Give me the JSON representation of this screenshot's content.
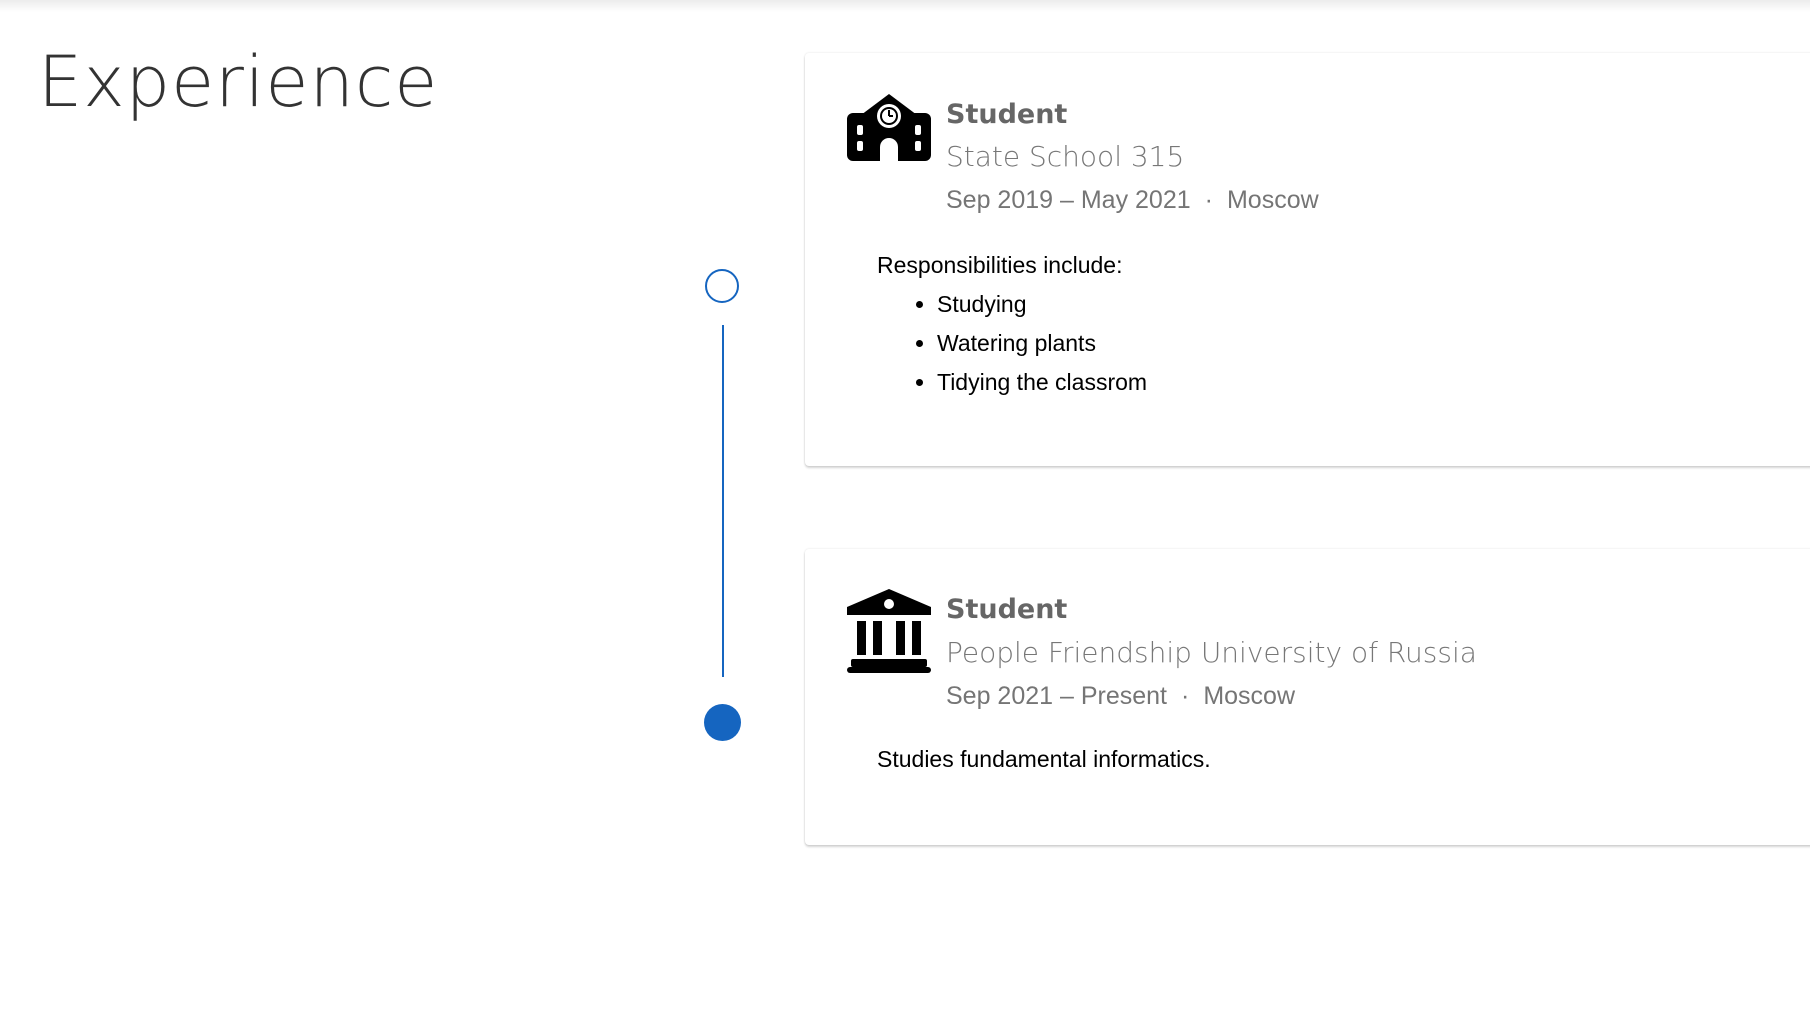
{
  "page": {
    "title": "Experience"
  },
  "colors": {
    "accent": "#1565c0",
    "muted_text": "#757575",
    "title_text": "#333333"
  },
  "timeline": {
    "items": [
      {
        "state": "open"
      },
      {
        "state": "filled"
      }
    ]
  },
  "entries": [
    {
      "icon": "school-icon",
      "title": "Student",
      "organization": "State School 315",
      "dates": "Sep 2019 – May 2021",
      "separator": "·",
      "location": "Moscow",
      "intro": "Responsibilities include:",
      "bullets": [
        "Studying",
        "Watering plants",
        "Tidying the classrom"
      ]
    },
    {
      "icon": "university-icon",
      "title": "Student",
      "organization": "People Friendship University of Russia",
      "dates": "Sep 2021 – Present",
      "separator": "·",
      "location": "Moscow",
      "intro": "Studies fundamental informatics."
    }
  ]
}
